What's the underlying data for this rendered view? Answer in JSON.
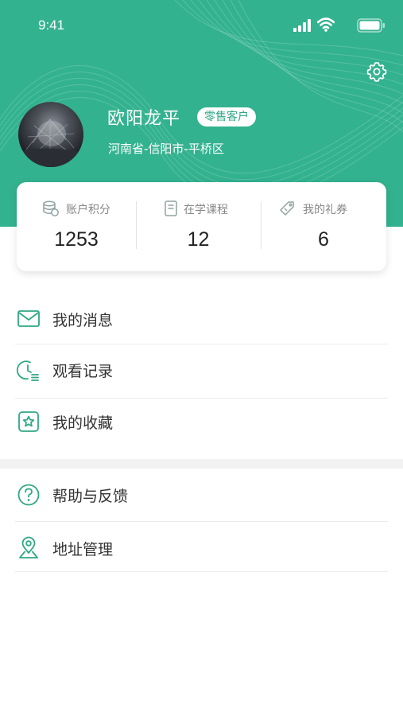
{
  "status_bar": {
    "time": "9:41"
  },
  "profile": {
    "name": "欧阳龙平",
    "badge": "零售客户",
    "address": "河南省-信阳市-平桥区"
  },
  "stats": [
    {
      "label": "账户积分",
      "value": "1253",
      "icon": "coins-icon"
    },
    {
      "label": "在学课程",
      "value": "12",
      "icon": "course-book-icon"
    },
    {
      "label": "我的礼券",
      "value": "6",
      "icon": "coupon-icon"
    }
  ],
  "menu_group_1": [
    {
      "label": "我的消息",
      "icon": "envelope-icon"
    },
    {
      "label": "观看记录",
      "icon": "history-clock-icon"
    },
    {
      "label": "我的收藏",
      "icon": "star-icon"
    }
  ],
  "menu_group_2": [
    {
      "label": "帮助与反馈",
      "icon": "help-icon"
    },
    {
      "label": "地址管理",
      "icon": "location-pin-icon"
    }
  ],
  "colors": {
    "brand": "#33b28f",
    "icon_accent": "#2fa882"
  }
}
